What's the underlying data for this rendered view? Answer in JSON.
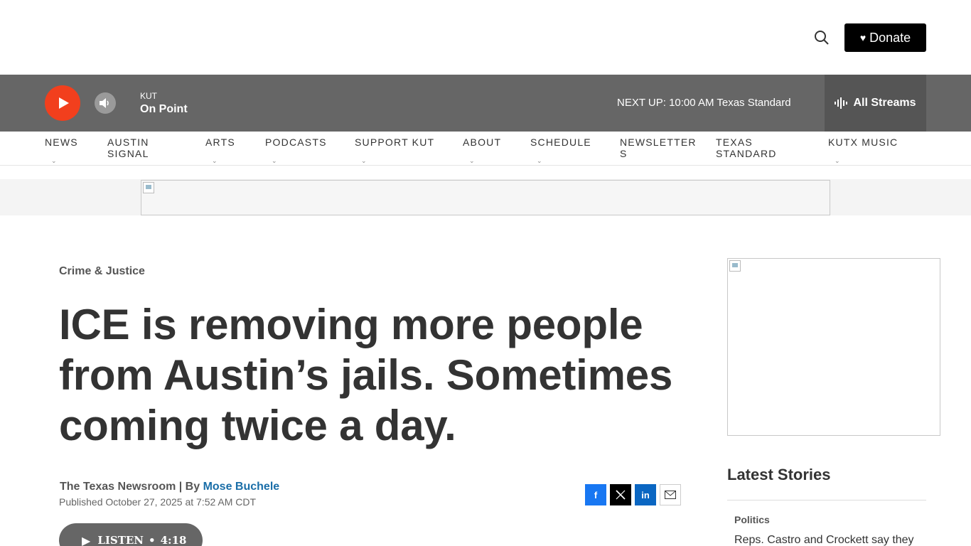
{
  "header": {
    "donate_label": "Donate"
  },
  "player": {
    "station": "KUT",
    "show": "On Point",
    "next_up_label": "NEXT UP:",
    "next_up_time": "10:00 AM",
    "next_up_show": "Texas Standard",
    "streams_label": "All Streams",
    "accent_color": "#f23f1d"
  },
  "nav": {
    "items": [
      {
        "line1": "NEWS",
        "line2": ""
      },
      {
        "line1": "AUSTIN",
        "line2": "SIGNAL"
      },
      {
        "line1": "ARTS",
        "line2": ""
      },
      {
        "line1": "PODCASTS",
        "line2": ""
      },
      {
        "line1": "SUPPORT KUT",
        "line2": ""
      },
      {
        "line1": "ABOUT",
        "line2": ""
      },
      {
        "line1": "SCHEDULE",
        "line2": ""
      },
      {
        "line1": "NEWSLETTER",
        "line2": "S"
      },
      {
        "line1": "TEXAS",
        "line2": "STANDARD"
      },
      {
        "line1": "KUTX MUSIC",
        "line2": ""
      }
    ]
  },
  "article": {
    "category": "Crime & Justice",
    "headline": "ICE is removing more people from Austin’s jails. Sometimes coming twice a day.",
    "source": "The Texas Newsroom | By ",
    "author": "Mose Buchele",
    "published": "Published October 27, 2025 at 7:52 AM CDT",
    "listen_label": "LISTEN",
    "listen_duration": "4:18"
  },
  "sidebar": {
    "latest_title": "Latest Stories",
    "story_category": "Politics",
    "story_title": "Reps. Castro and Crockett say they"
  }
}
